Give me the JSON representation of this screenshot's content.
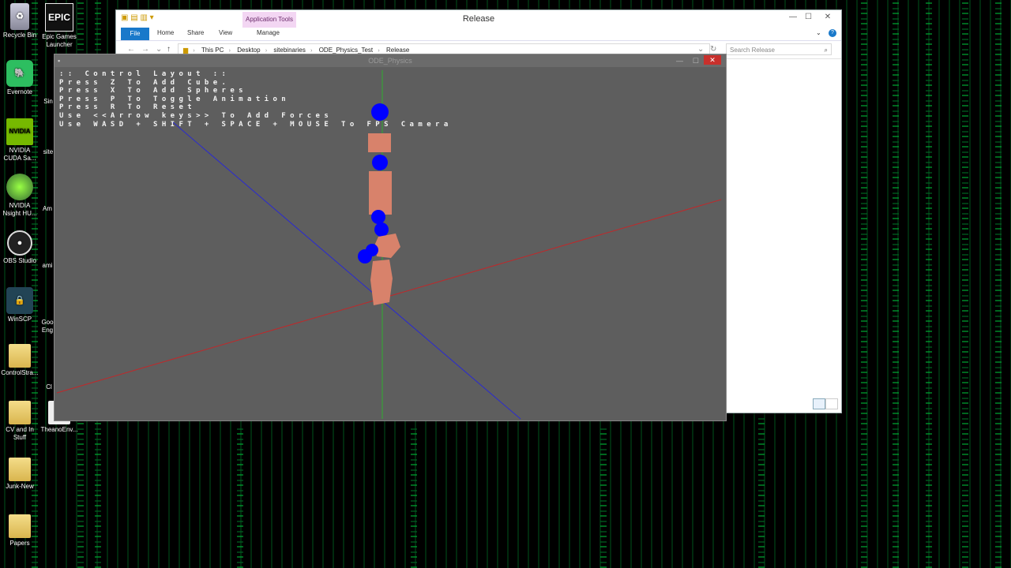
{
  "desktop": {
    "icons": [
      {
        "label": "Recycle Bin"
      },
      {
        "label": "Epic Games Launcher"
      },
      {
        "label": "Evernote"
      },
      {
        "label": "NVIDIA CUDA Sa..."
      },
      {
        "label": "NVIDIA Nsight HU..."
      },
      {
        "label": "OBS Studio"
      },
      {
        "label": "WinSCP"
      },
      {
        "label": "ControlStra..."
      },
      {
        "label": "CV and In Stuff"
      },
      {
        "label": "Junk-New"
      },
      {
        "label": "Papers"
      },
      {
        "label": "TheanoEnv..."
      }
    ],
    "partial_labels": [
      "Sin",
      "site",
      "Am",
      "ami",
      "Goo Eng",
      "Cl"
    ]
  },
  "explorer": {
    "title": "Release",
    "app_tools_label": "Application Tools",
    "tabs": [
      "File",
      "Home",
      "Share",
      "View",
      "Manage"
    ],
    "breadcrumb": [
      "This PC",
      "Desktop",
      "sitebinaries",
      "ODE_Physics_Test",
      "Release"
    ],
    "search_placeholder": "Search Release"
  },
  "ode_window": {
    "title": "ODE_Physics",
    "controls_text": ":: Control Layout ::\nPress Z To Add Cube.\nPress X To Add Spheres\nPress P To Toggle Animation\nPress R To Reset\nUse <<Arrow keys>> To Add Forces\nUse WASD + SHIFT + SPACE + MOUSE To FPS Camera",
    "colors": {
      "background": "#5e5e5e",
      "sphere": "#0000ff",
      "cube": "#d8826b",
      "axis_x": "#c0282a",
      "axis_y": "#2fae2f",
      "axis_z": "#2a2ad0"
    }
  }
}
